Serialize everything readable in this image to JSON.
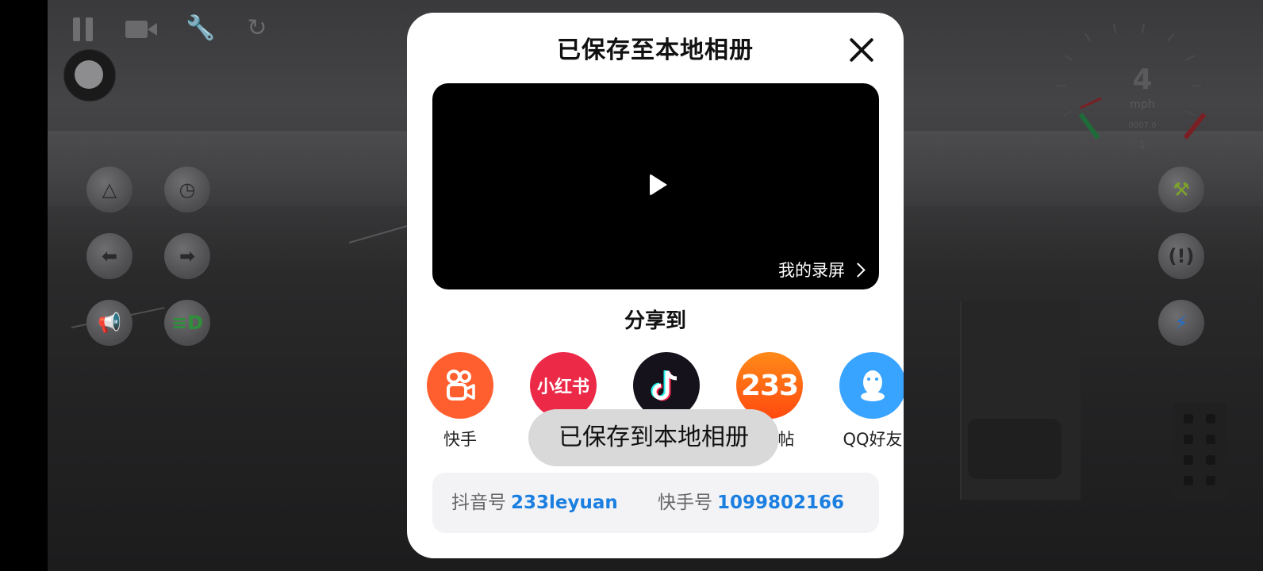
{
  "game": {
    "speed": "4",
    "speed_unit": "mph",
    "odometer": "0007.0",
    "gear": "1"
  },
  "modal": {
    "title": "已保存至本地相册",
    "my_recordings_label": "我的录屏",
    "share_title": "分享到",
    "share_targets": [
      {
        "label": "快手",
        "icon": "kuaishou-icon",
        "color": "#ff5f2e"
      },
      {
        "label": "小红书",
        "icon": "xiaohongshu-icon",
        "icon_text": "小红书",
        "color": "#ec2a48"
      },
      {
        "label": "抖音",
        "icon": "douyin-icon",
        "color": "#16121c"
      },
      {
        "label": "视频帖",
        "icon": "233-icon",
        "icon_text": "233",
        "color": "#ff6a14"
      },
      {
        "label": "QQ好友",
        "icon": "qq-icon",
        "color": "#39a4ff"
      }
    ],
    "toast": "已保存到本地相册",
    "accounts": [
      {
        "key": "抖音号",
        "value": "233leyuan"
      },
      {
        "key": "快手号",
        "value": "1099802166"
      }
    ]
  }
}
